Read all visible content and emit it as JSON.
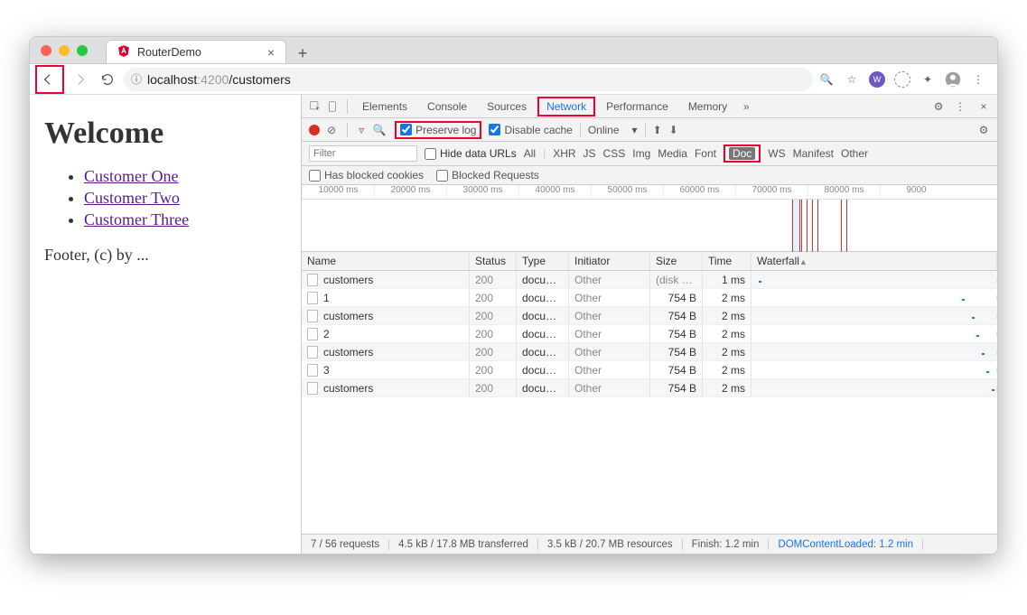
{
  "tab": {
    "title": "RouterDemo"
  },
  "url": {
    "prefix": "localhost",
    "port": ":4200",
    "path": "/customers"
  },
  "page": {
    "heading": "Welcome",
    "links": [
      "Customer One",
      "Customer Two",
      "Customer Three"
    ],
    "footer": "Footer, (c) by ..."
  },
  "devtools": {
    "tabs": [
      "Elements",
      "Console",
      "Sources",
      "Network",
      "Performance",
      "Memory"
    ],
    "preserve_log": "Preserve log",
    "disable_cache": "Disable cache",
    "throttle": "Online",
    "filter_placeholder": "Filter",
    "hide_urls": "Hide data URLs",
    "filter_tabs": [
      "All",
      "XHR",
      "JS",
      "CSS",
      "Img",
      "Media",
      "Font",
      "Doc",
      "WS",
      "Manifest",
      "Other"
    ],
    "blocked_cookies": "Has blocked cookies",
    "blocked_requests": "Blocked Requests",
    "timeline_ticks": [
      "10000 ms",
      "20000 ms",
      "30000 ms",
      "40000 ms",
      "50000 ms",
      "60000 ms",
      "70000 ms",
      "80000 ms",
      "9000"
    ],
    "columns": {
      "name": "Name",
      "status": "Status",
      "type": "Type",
      "initiator": "Initiator",
      "size": "Size",
      "time": "Time",
      "waterfall": "Waterfall"
    },
    "rows": [
      {
        "name": "customers",
        "status": "200",
        "type": "docu…",
        "initiator": "Other",
        "size": "(disk c…",
        "time": "1 ms",
        "wf": 3
      },
      {
        "name": "1",
        "status": "200",
        "type": "docu…",
        "initiator": "Other",
        "size": "754 B",
        "time": "2 ms",
        "wf": 86
      },
      {
        "name": "customers",
        "status": "200",
        "type": "docu…",
        "initiator": "Other",
        "size": "754 B",
        "time": "2 ms",
        "wf": 90
      },
      {
        "name": "2",
        "status": "200",
        "type": "docu…",
        "initiator": "Other",
        "size": "754 B",
        "time": "2 ms",
        "wf": 92
      },
      {
        "name": "customers",
        "status": "200",
        "type": "docu…",
        "initiator": "Other",
        "size": "754 B",
        "time": "2 ms",
        "wf": 94
      },
      {
        "name": "3",
        "status": "200",
        "type": "docu…",
        "initiator": "Other",
        "size": "754 B",
        "time": "2 ms",
        "wf": 96
      },
      {
        "name": "customers",
        "status": "200",
        "type": "docu…",
        "initiator": "Other",
        "size": "754 B",
        "time": "2 ms",
        "wf": 98
      }
    ],
    "status": {
      "requests": "7 / 56 requests",
      "transferred": "4.5 kB / 17.8 MB transferred",
      "resources": "3.5 kB / 20.7 MB resources",
      "finish": "Finish: 1.2 min",
      "dcl": "DOMContentLoaded: 1.2 min"
    }
  }
}
